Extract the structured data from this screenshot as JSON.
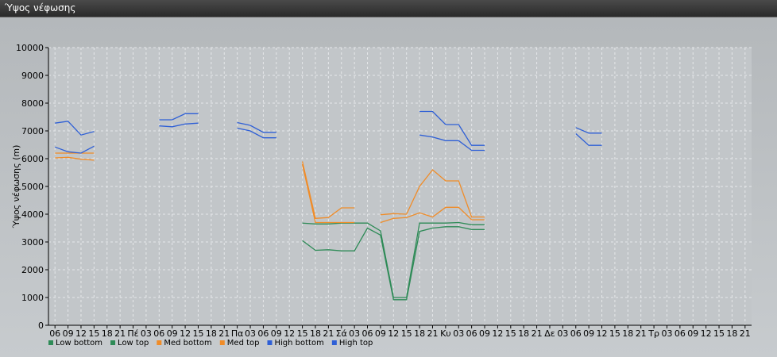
{
  "window": {
    "title": "Ύψος νέφωσης"
  },
  "chart_data": {
    "type": "line",
    "title": "",
    "ylabel": "Ύψος νέφωσης (m)",
    "xlabel": "",
    "ylim": [
      0,
      10000
    ],
    "y_ticks": [
      0,
      1000,
      2000,
      3000,
      4000,
      5000,
      6000,
      7000,
      8000,
      9000,
      10000
    ],
    "x_ticks": [
      "06",
      "09",
      "12",
      "15",
      "18",
      "21",
      "Πέ",
      "03",
      "06",
      "09",
      "12",
      "15",
      "18",
      "21",
      "Πα",
      "03",
      "06",
      "09",
      "12",
      "15",
      "18",
      "21",
      "Σά",
      "03",
      "06",
      "09",
      "12",
      "15",
      "18",
      "21",
      "Κυ",
      "03",
      "06",
      "09",
      "12",
      "15",
      "18",
      "21",
      "Δε",
      "03",
      "06",
      "09",
      "12",
      "15",
      "18",
      "21",
      "Τρ",
      "03",
      "06",
      "09",
      "12",
      "15",
      "18",
      "21"
    ],
    "grid": true,
    "legend_position": "bottom-left",
    "series": [
      {
        "name": "Low bottom",
        "color": "#2e8b57",
        "values": [
          null,
          null,
          null,
          null,
          null,
          null,
          null,
          null,
          null,
          null,
          null,
          null,
          null,
          null,
          null,
          null,
          null,
          null,
          null,
          3050,
          2700,
          2720,
          2680,
          2680,
          3500,
          3250,
          920,
          920,
          3380,
          3500,
          3550,
          3550,
          3450,
          3450,
          null,
          null,
          null,
          null,
          null,
          null,
          null,
          null,
          null,
          null,
          null,
          null,
          null,
          null,
          null,
          null,
          null,
          null,
          null,
          null
        ]
      },
      {
        "name": "Low top",
        "color": "#2e8b57",
        "values": [
          null,
          null,
          null,
          null,
          null,
          null,
          null,
          null,
          null,
          null,
          null,
          null,
          null,
          null,
          null,
          null,
          null,
          null,
          null,
          3680,
          3650,
          3650,
          3680,
          3680,
          3680,
          3400,
          1000,
          1000,
          3680,
          3680,
          3680,
          3700,
          3620,
          3620,
          null,
          null,
          null,
          null,
          null,
          null,
          null,
          null,
          null,
          null,
          null,
          null,
          null,
          null,
          null,
          null,
          null,
          null,
          null,
          null
        ]
      },
      {
        "name": "Med bottom",
        "color": "#f08c28",
        "values": [
          6030,
          6050,
          5980,
          5950,
          null,
          null,
          null,
          null,
          null,
          null,
          null,
          null,
          null,
          null,
          null,
          null,
          null,
          null,
          null,
          5800,
          3700,
          3700,
          3700,
          3700,
          null,
          3700,
          3850,
          3880,
          4050,
          3900,
          4250,
          4250,
          3800,
          3800,
          null,
          null,
          null,
          null,
          null,
          null,
          null,
          null,
          null,
          null,
          null,
          null,
          null,
          null,
          null,
          null,
          null,
          null,
          null,
          null
        ]
      },
      {
        "name": "Med top",
        "color": "#f08c28",
        "values": [
          6200,
          6200,
          6200,
          6200,
          null,
          null,
          null,
          null,
          null,
          null,
          null,
          null,
          null,
          null,
          null,
          null,
          null,
          null,
          null,
          5900,
          3850,
          3880,
          4230,
          4230,
          null,
          3980,
          4020,
          4000,
          5000,
          5600,
          5200,
          5200,
          3900,
          3900,
          null,
          null,
          null,
          null,
          null,
          null,
          null,
          null,
          null,
          null,
          null,
          null,
          null,
          null,
          null,
          null,
          null,
          null,
          null,
          null
        ]
      },
      {
        "name": "High bottom",
        "color": "#2e5fd6",
        "values": [
          6420,
          6250,
          6200,
          6450,
          null,
          null,
          null,
          null,
          7180,
          7150,
          7250,
          7280,
          null,
          null,
          7100,
          7000,
          6750,
          6750,
          null,
          null,
          null,
          null,
          null,
          null,
          null,
          null,
          null,
          null,
          6850,
          6780,
          6650,
          6650,
          6300,
          6300,
          null,
          null,
          null,
          null,
          null,
          null,
          6900,
          6480,
          6480,
          null,
          null,
          null,
          null,
          null,
          null,
          null,
          null,
          null,
          null,
          null
        ]
      },
      {
        "name": "High top",
        "color": "#2e5fd6",
        "values": [
          7280,
          7350,
          6850,
          6980,
          null,
          null,
          null,
          null,
          7400,
          7400,
          7620,
          7620,
          null,
          null,
          7300,
          7200,
          6950,
          6950,
          null,
          null,
          null,
          null,
          null,
          null,
          null,
          null,
          null,
          null,
          7700,
          7700,
          7230,
          7230,
          6480,
          6480,
          null,
          null,
          null,
          null,
          null,
          null,
          7120,
          6920,
          6920,
          null,
          null,
          null,
          null,
          null,
          null,
          null,
          null,
          null,
          null,
          null
        ]
      }
    ]
  }
}
